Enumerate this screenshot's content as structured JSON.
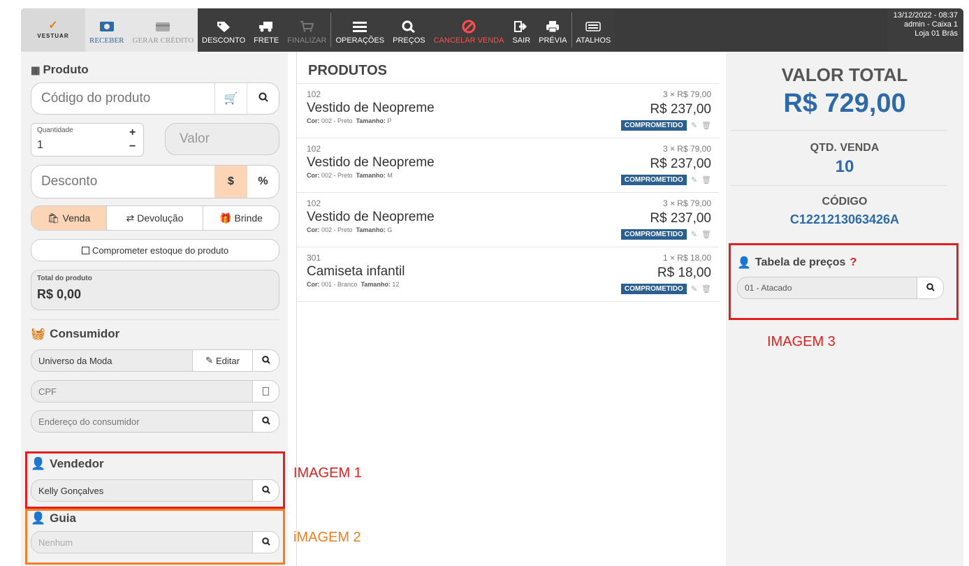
{
  "brand": {
    "logo_text": "VESTUAR"
  },
  "toolbar": {
    "receber": "RECEBER",
    "gerar_credito": "GERAR CRÉDITO",
    "desconto": "DESCONTO",
    "frete": "FRETE",
    "finalizar": "FINALIZAR",
    "operacoes": "OPERAÇÕES",
    "precos": "PREÇOS",
    "cancelar": "CANCELAR VENDA",
    "sair": "SAIR",
    "previa": "PRÉVIA",
    "atalhos": "ATALHOS"
  },
  "session": {
    "datetime": "13/12/2022 - 08:37",
    "user": "admin - Caixa 1",
    "store": "Loja 01 Brás"
  },
  "produto": {
    "title": "Produto",
    "code_placeholder": "Código do produto",
    "quantidade_label": "Quantidade",
    "quantidade_value": "1",
    "valor_placeholder": "Valor",
    "desconto_placeholder": "Desconto",
    "desconto_currency": "$",
    "desconto_percent": "%",
    "modes": [
      "Venda",
      "Devolução",
      "Brinde"
    ],
    "comprometer": "Comprometer estoque do produto",
    "total_label": "Total do produto",
    "total_value": "R$ 0,00"
  },
  "consumidor": {
    "title": "Consumidor",
    "name": "Universo da Moda",
    "edit_label": "Editar",
    "cpf_placeholder": "CPF",
    "endereco_placeholder": "Endereço do consumidor"
  },
  "vendedor": {
    "title": "Vendedor",
    "name": "Kelly Gonçalves"
  },
  "guia": {
    "title": "Guia",
    "name": "Nenhum"
  },
  "produtos": {
    "title": "PRODUTOS",
    "items": [
      {
        "code": "102",
        "name": "Vestido de Neopreme",
        "qty": "3 × R$ 79,00",
        "price": "R$ 237,00",
        "cor": "002 - Preto",
        "tamanho": "P",
        "badge": "COMPROMETIDO"
      },
      {
        "code": "102",
        "name": "Vestido de Neopreme",
        "qty": "3 × R$ 79,00",
        "price": "R$ 237,00",
        "cor": "002 - Preto",
        "tamanho": "M",
        "badge": "COMPROMETIDO"
      },
      {
        "code": "102",
        "name": "Vestido de Neopreme",
        "qty": "3 × R$ 79,00",
        "price": "R$ 237,00",
        "cor": "002 - Preto",
        "tamanho": "G",
        "badge": "COMPROMETIDO"
      },
      {
        "code": "301",
        "name": "Camiseta infantil",
        "qty": "1 × R$ 18,00",
        "price": "R$ 18,00",
        "cor": "001 - Branco",
        "tamanho": "12",
        "badge": "COMPROMETIDO"
      }
    ],
    "cor_label": "Cor:",
    "tamanho_label": "Tamanho:"
  },
  "resumo": {
    "valor_total_label": "VALOR TOTAL",
    "valor_total": "R$ 729,00",
    "qtd_label": "QTD. VENDA",
    "qtd_value": "10",
    "codigo_label": "CÓDIGO",
    "codigo_value": "C1221213063426A",
    "tabela_label": "Tabela de preços",
    "tabela_help": "?",
    "tabela_value": "01 - Atacado"
  },
  "annotations": {
    "img1": "IMAGEM 1",
    "img2": "iMAGEM 2",
    "img3": "IMAGEM 3"
  },
  "colors": {
    "accent_blue": "#2d6aa7",
    "danger": "#e0201f",
    "orange": "#f07f25"
  }
}
